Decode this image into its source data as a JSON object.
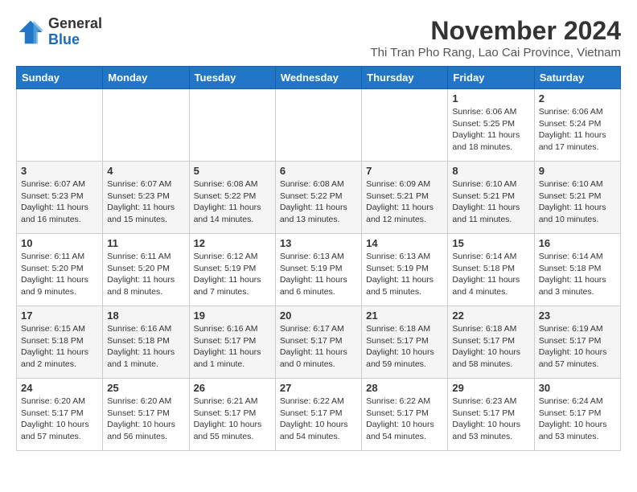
{
  "header": {
    "logo": {
      "general": "General",
      "blue": "Blue"
    },
    "title": "November 2024",
    "location": "Thi Tran Pho Rang, Lao Cai Province, Vietnam"
  },
  "weekdays": [
    "Sunday",
    "Monday",
    "Tuesday",
    "Wednesday",
    "Thursday",
    "Friday",
    "Saturday"
  ],
  "weeks": [
    [
      {
        "day": "",
        "info": ""
      },
      {
        "day": "",
        "info": ""
      },
      {
        "day": "",
        "info": ""
      },
      {
        "day": "",
        "info": ""
      },
      {
        "day": "",
        "info": ""
      },
      {
        "day": "1",
        "info": "Sunrise: 6:06 AM\nSunset: 5:25 PM\nDaylight: 11 hours and 18 minutes."
      },
      {
        "day": "2",
        "info": "Sunrise: 6:06 AM\nSunset: 5:24 PM\nDaylight: 11 hours and 17 minutes."
      }
    ],
    [
      {
        "day": "3",
        "info": "Sunrise: 6:07 AM\nSunset: 5:23 PM\nDaylight: 11 hours and 16 minutes."
      },
      {
        "day": "4",
        "info": "Sunrise: 6:07 AM\nSunset: 5:23 PM\nDaylight: 11 hours and 15 minutes."
      },
      {
        "day": "5",
        "info": "Sunrise: 6:08 AM\nSunset: 5:22 PM\nDaylight: 11 hours and 14 minutes."
      },
      {
        "day": "6",
        "info": "Sunrise: 6:08 AM\nSunset: 5:22 PM\nDaylight: 11 hours and 13 minutes."
      },
      {
        "day": "7",
        "info": "Sunrise: 6:09 AM\nSunset: 5:21 PM\nDaylight: 11 hours and 12 minutes."
      },
      {
        "day": "8",
        "info": "Sunrise: 6:10 AM\nSunset: 5:21 PM\nDaylight: 11 hours and 11 minutes."
      },
      {
        "day": "9",
        "info": "Sunrise: 6:10 AM\nSunset: 5:21 PM\nDaylight: 11 hours and 10 minutes."
      }
    ],
    [
      {
        "day": "10",
        "info": "Sunrise: 6:11 AM\nSunset: 5:20 PM\nDaylight: 11 hours and 9 minutes."
      },
      {
        "day": "11",
        "info": "Sunrise: 6:11 AM\nSunset: 5:20 PM\nDaylight: 11 hours and 8 minutes."
      },
      {
        "day": "12",
        "info": "Sunrise: 6:12 AM\nSunset: 5:19 PM\nDaylight: 11 hours and 7 minutes."
      },
      {
        "day": "13",
        "info": "Sunrise: 6:13 AM\nSunset: 5:19 PM\nDaylight: 11 hours and 6 minutes."
      },
      {
        "day": "14",
        "info": "Sunrise: 6:13 AM\nSunset: 5:19 PM\nDaylight: 11 hours and 5 minutes."
      },
      {
        "day": "15",
        "info": "Sunrise: 6:14 AM\nSunset: 5:18 PM\nDaylight: 11 hours and 4 minutes."
      },
      {
        "day": "16",
        "info": "Sunrise: 6:14 AM\nSunset: 5:18 PM\nDaylight: 11 hours and 3 minutes."
      }
    ],
    [
      {
        "day": "17",
        "info": "Sunrise: 6:15 AM\nSunset: 5:18 PM\nDaylight: 11 hours and 2 minutes."
      },
      {
        "day": "18",
        "info": "Sunrise: 6:16 AM\nSunset: 5:18 PM\nDaylight: 11 hours and 1 minute."
      },
      {
        "day": "19",
        "info": "Sunrise: 6:16 AM\nSunset: 5:17 PM\nDaylight: 11 hours and 1 minute."
      },
      {
        "day": "20",
        "info": "Sunrise: 6:17 AM\nSunset: 5:17 PM\nDaylight: 11 hours and 0 minutes."
      },
      {
        "day": "21",
        "info": "Sunrise: 6:18 AM\nSunset: 5:17 PM\nDaylight: 10 hours and 59 minutes."
      },
      {
        "day": "22",
        "info": "Sunrise: 6:18 AM\nSunset: 5:17 PM\nDaylight: 10 hours and 58 minutes."
      },
      {
        "day": "23",
        "info": "Sunrise: 6:19 AM\nSunset: 5:17 PM\nDaylight: 10 hours and 57 minutes."
      }
    ],
    [
      {
        "day": "24",
        "info": "Sunrise: 6:20 AM\nSunset: 5:17 PM\nDaylight: 10 hours and 57 minutes."
      },
      {
        "day": "25",
        "info": "Sunrise: 6:20 AM\nSunset: 5:17 PM\nDaylight: 10 hours and 56 minutes."
      },
      {
        "day": "26",
        "info": "Sunrise: 6:21 AM\nSunset: 5:17 PM\nDaylight: 10 hours and 55 minutes."
      },
      {
        "day": "27",
        "info": "Sunrise: 6:22 AM\nSunset: 5:17 PM\nDaylight: 10 hours and 54 minutes."
      },
      {
        "day": "28",
        "info": "Sunrise: 6:22 AM\nSunset: 5:17 PM\nDaylight: 10 hours and 54 minutes."
      },
      {
        "day": "29",
        "info": "Sunrise: 6:23 AM\nSunset: 5:17 PM\nDaylight: 10 hours and 53 minutes."
      },
      {
        "day": "30",
        "info": "Sunrise: 6:24 AM\nSunset: 5:17 PM\nDaylight: 10 hours and 53 minutes."
      }
    ]
  ]
}
